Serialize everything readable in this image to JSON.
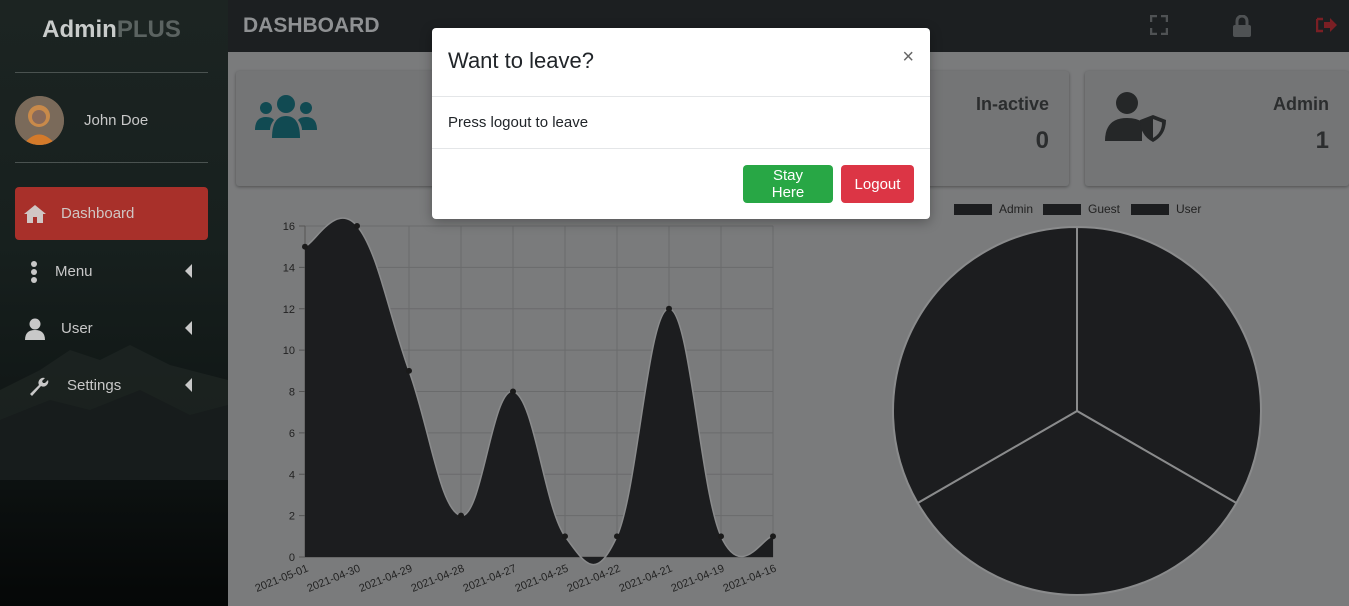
{
  "brand": {
    "part1": "Admin",
    "part2": "PLUS"
  },
  "user": {
    "name": "John Doe"
  },
  "sidebar": {
    "items": [
      {
        "label": "Dashboard",
        "icon": "home-icon",
        "active": true
      },
      {
        "label": "Menu",
        "icon": "vertical-dots-icon",
        "active": false
      },
      {
        "label": "User",
        "icon": "user-icon",
        "active": false
      },
      {
        "label": "Settings",
        "icon": "wrench-icon",
        "active": false
      }
    ]
  },
  "header": {
    "title": "DASHBOARD",
    "icons": [
      "fullscreen-icon",
      "lock-icon",
      "sign-out-icon"
    ]
  },
  "cards": [
    {
      "label": "",
      "value": "",
      "icon": "users-icon"
    },
    {
      "label": "In-active",
      "value": "0"
    },
    {
      "label": "Admin",
      "value": "1",
      "icon": "user-shield-icon"
    }
  ],
  "modal": {
    "title": "Want to leave?",
    "close": "×",
    "body": "Press logout to leave",
    "stay_label": "Stay Here",
    "logout_label": "Logout"
  },
  "colors": {
    "danger": "#dc3545",
    "success": "#28a745",
    "sidebar_active": "#a8302a",
    "chart_fill": "#1c1d1f"
  },
  "chart_data": [
    {
      "type": "area",
      "x": [
        "2021-05-01",
        "2021-04-30",
        "2021-04-29",
        "2021-04-28",
        "2021-04-27",
        "2021-04-25",
        "2021-04-22",
        "2021-04-21",
        "2021-04-19",
        "2021-04-16"
      ],
      "values": [
        15,
        16,
        9,
        2,
        8,
        1,
        1,
        12,
        1,
        1
      ],
      "ylim": [
        0,
        16
      ],
      "yticks": [
        "0",
        "2",
        "4",
        "6",
        "8",
        "10",
        "12",
        "14",
        "16"
      ],
      "grid": true
    },
    {
      "type": "pie",
      "legend": [
        "Admin",
        "Guest",
        "User"
      ],
      "values": [
        1,
        1,
        1
      ],
      "legend_position": "top"
    }
  ]
}
